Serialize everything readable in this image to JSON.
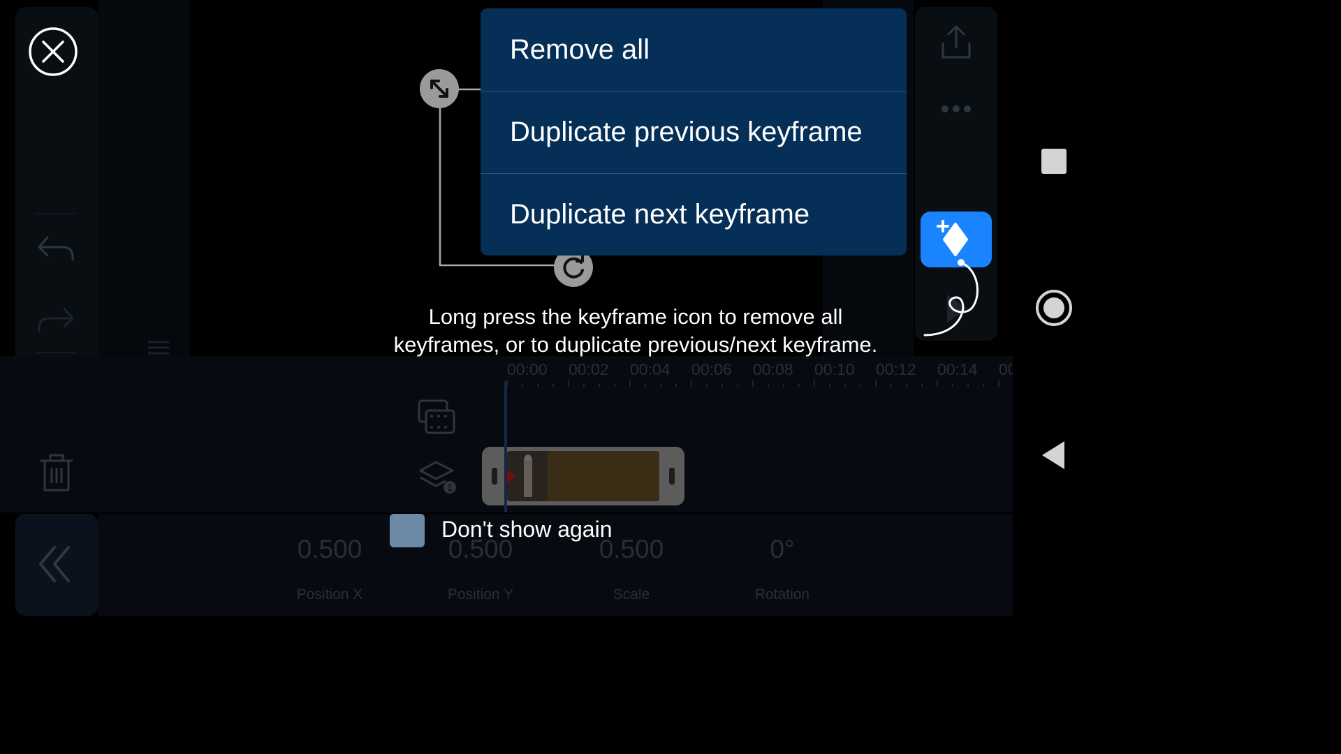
{
  "menu": {
    "items": [
      "Remove all",
      "Duplicate previous keyframe",
      "Duplicate next keyframe"
    ]
  },
  "hint": {
    "line1": "Long press the keyframe icon to remove all",
    "line2": "keyframes, or to duplicate previous/next keyframe."
  },
  "dont_show_again": {
    "label": "Don't show again",
    "checked": false
  },
  "timeline": {
    "ticks": [
      "00:00",
      "00:02",
      "00:04",
      "00:06",
      "00:08",
      "00:10",
      "00:12",
      "00:14",
      "00"
    ]
  },
  "properties": [
    {
      "value": "0.500",
      "label": "Position X"
    },
    {
      "value": "0.500",
      "label": "Position Y"
    },
    {
      "value": "0.500",
      "label": "Scale"
    },
    {
      "value": "0°",
      "label": "Rotation"
    }
  ],
  "icons": {
    "close": "close-icon",
    "undo": "undo-icon",
    "redo": "redo-icon",
    "delete": "trash-icon",
    "collapse": "double-chevron-left-icon",
    "export": "share-icon",
    "more": "more-icon",
    "keyframe": "keyframe-diamond-icon",
    "resize": "resize-handle-icon",
    "rotate": "rotate-handle-icon"
  },
  "colors": {
    "menu_bg": "#062f57",
    "keyframe_accent": "#1a84ff"
  }
}
